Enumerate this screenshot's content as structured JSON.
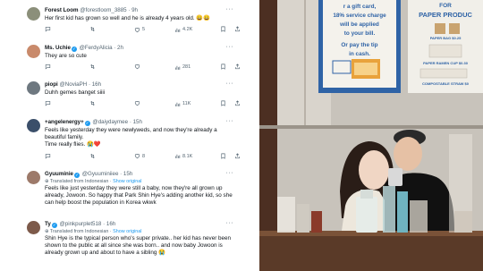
{
  "tweets": [
    {
      "name": "Forest Loom",
      "handle": "@forestloom_3885",
      "time": "· 9h",
      "verified": false,
      "text": "Her first kid has grown so well and he is already 4 years old. 😀😀",
      "replies": "",
      "retweets": "",
      "likes": "5",
      "views": "4.2K"
    },
    {
      "name": "Ms. Uchie",
      "handle": "@FerdyAlicia",
      "time": "· 2h",
      "verified": true,
      "text": "They are so cute",
      "replies": "",
      "retweets": "",
      "likes": "",
      "views": "281"
    },
    {
      "name": "piopi",
      "handle": "@NoviaPH",
      "time": "· 16h",
      "verified": false,
      "text": "Duhh gemes banget siiii",
      "replies": "",
      "retweets": "",
      "likes": "",
      "views": "11K"
    },
    {
      "name": "+angelenergy+",
      "handle": "@daiydaymee",
      "time": "· 15h",
      "verified": true,
      "text": "Feels like yesterday they were newlyweds, and now they're already a beautiful family.\nTime really flies. 😭❤️",
      "replies": "",
      "retweets": "",
      "likes": "8",
      "views": "8.1K"
    },
    {
      "name": "Gyuuminie",
      "handle": "@Gyuuminiiee",
      "time": "· 15h",
      "verified": true,
      "translation": "Translated from Indonesian",
      "translation_link": "Show original",
      "text": "Feels like just yesterday they were still a baby, now they're all grown up already, Jowoon. So happy that Park Shin Hye's adding another kid, so she can help boost the population in Korea wkwk",
      "replies": "",
      "retweets": "",
      "likes": "",
      "views": ""
    },
    {
      "name": "Ty",
      "handle": "@pinkpurplet518",
      "time": "· 16h",
      "verified": true,
      "translation": "Translated from Indonesian",
      "translation_link": "Show original",
      "text": "Shin Hye is the typical person who's super private.. her kid has never been shown to the public at all since she was born.. and now baby Jowoon is already grown up and about to have a sibling 😭",
      "replies": "",
      "retweets": "",
      "likes": "",
      "views": ""
    }
  ],
  "more_icon": "···",
  "photo": {
    "poster1": [
      "r a gift card,",
      "18% service charge",
      "will be applied",
      "to your bill.",
      "Or pay the tip",
      "in cash."
    ],
    "poster2_title": [
      "FOR",
      "PAPER PRODUC"
    ],
    "poster2_items": [
      "PAPER BAG $0.25",
      "PAPER RAMEN CUP $0.30",
      "COMPOSTABLE STRAW $0"
    ],
    "colors": {
      "wall": "#c8c3bb",
      "wood": "#5a3a28",
      "shirt": "#111111",
      "poster_blue": "#2f63a6"
    }
  }
}
